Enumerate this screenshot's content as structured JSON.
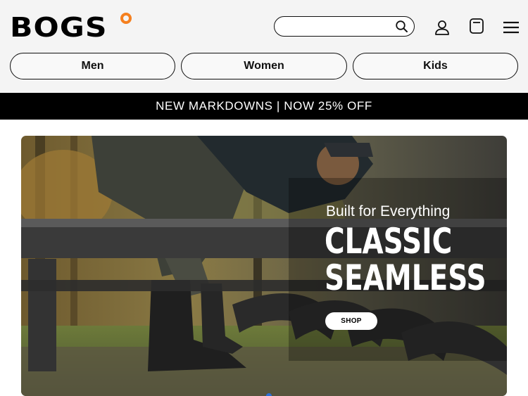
{
  "brand": {
    "logo_text": "BOGS",
    "accent_color": "#f5801f"
  },
  "header": {
    "search": {
      "value": "",
      "placeholder": ""
    },
    "icons": [
      "search-icon",
      "account-icon",
      "cart-icon",
      "menu-icon"
    ]
  },
  "nav": {
    "items": [
      {
        "label": "Men"
      },
      {
        "label": "Women"
      },
      {
        "label": "Kids"
      }
    ]
  },
  "promo": {
    "text": "NEW MARKDOWNS | NOW 25% OFF",
    "background": "#000000"
  },
  "hero": {
    "subtitle": "Built for Everything",
    "title_line1": "CLASSIC",
    "title_line2": "SEAMLESS",
    "cta_label": "SHOP"
  }
}
